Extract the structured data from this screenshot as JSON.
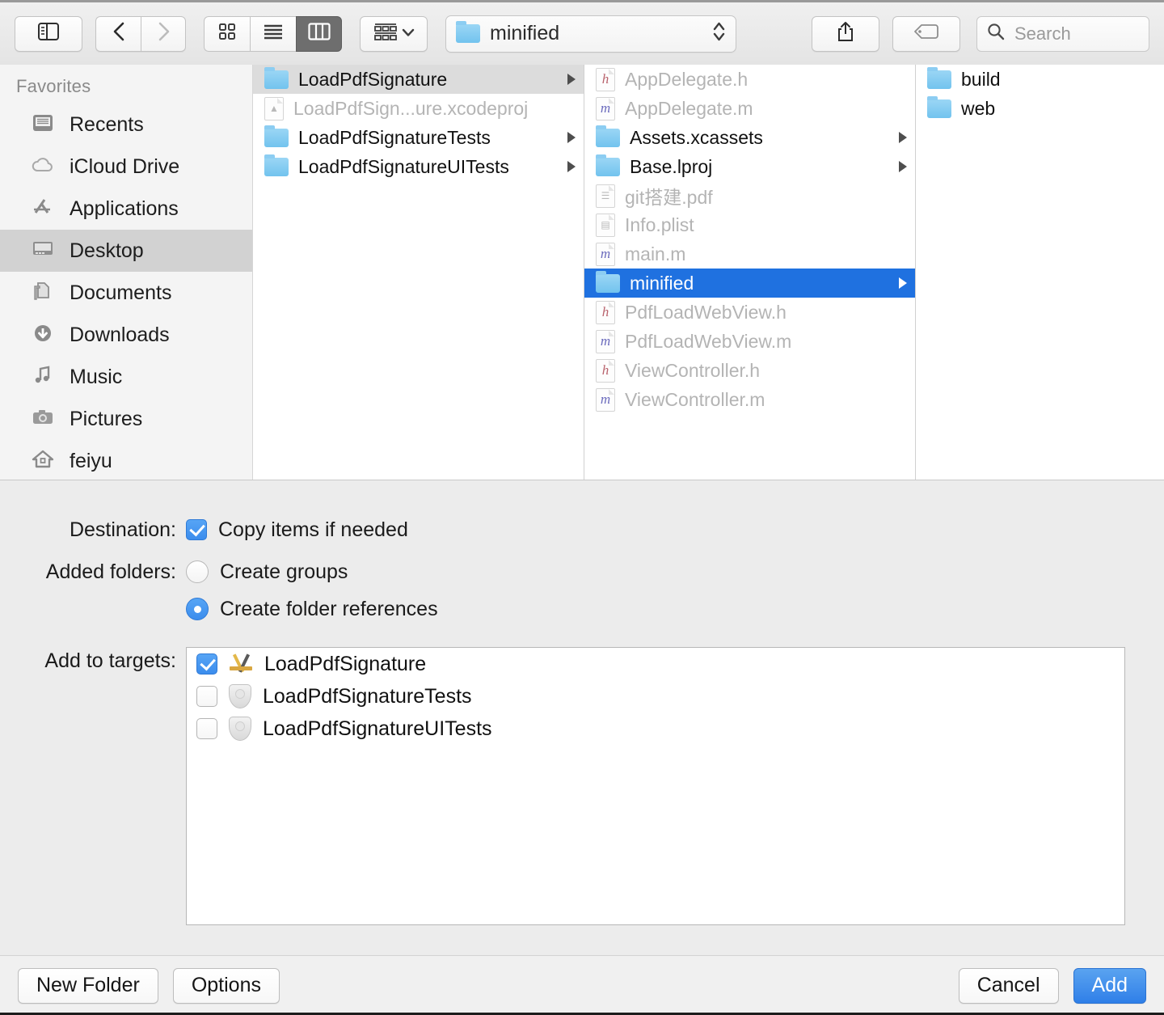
{
  "toolbar": {
    "sidebar_toggle": "sidebar-toggle",
    "back": "back",
    "forward": "forward",
    "view_icon": "icon-view",
    "view_list": "list-view",
    "view_column": "column-view",
    "arrange": "arrange",
    "path_label": "minified",
    "share": "share",
    "tag": "tag",
    "search_placeholder": "Search"
  },
  "sidebar": {
    "header": "Favorites",
    "items": [
      {
        "label": "Recents",
        "icon": "recents-icon",
        "selected": false
      },
      {
        "label": "iCloud Drive",
        "icon": "icloud-icon",
        "selected": false
      },
      {
        "label": "Applications",
        "icon": "applications-icon",
        "selected": false
      },
      {
        "label": "Desktop",
        "icon": "desktop-icon",
        "selected": true
      },
      {
        "label": "Documents",
        "icon": "documents-icon",
        "selected": false
      },
      {
        "label": "Downloads",
        "icon": "downloads-icon",
        "selected": false
      },
      {
        "label": "Music",
        "icon": "music-icon",
        "selected": false
      },
      {
        "label": "Pictures",
        "icon": "pictures-icon",
        "selected": false
      },
      {
        "label": "feiyu",
        "icon": "home-icon",
        "selected": false
      }
    ]
  },
  "columns": [
    {
      "name": "column-1",
      "rows": [
        {
          "label": "LoadPdfSignature",
          "icon": "folder-icon",
          "state": "highlighted",
          "arrow": true,
          "dimmed": false
        },
        {
          "label": "LoadPdfSign...ure.xcodeproj",
          "icon": "xcodeproj-icon",
          "state": "normal",
          "arrow": false,
          "dimmed": true
        },
        {
          "label": "LoadPdfSignatureTests",
          "icon": "folder-icon",
          "state": "normal",
          "arrow": true,
          "dimmed": false
        },
        {
          "label": "LoadPdfSignatureUITests",
          "icon": "folder-icon",
          "state": "normal",
          "arrow": true,
          "dimmed": false
        }
      ]
    },
    {
      "name": "column-2",
      "rows": [
        {
          "label": "AppDelegate.h",
          "icon": "h-file-icon",
          "state": "normal",
          "arrow": false,
          "dimmed": true
        },
        {
          "label": "AppDelegate.m",
          "icon": "m-file-icon",
          "state": "normal",
          "arrow": false,
          "dimmed": true
        },
        {
          "label": "Assets.xcassets",
          "icon": "folder-icon",
          "state": "normal",
          "arrow": true,
          "dimmed": false
        },
        {
          "label": "Base.lproj",
          "icon": "folder-icon",
          "state": "normal",
          "arrow": true,
          "dimmed": false
        },
        {
          "label": "git搭建.pdf",
          "icon": "pdf-file-icon",
          "state": "normal",
          "arrow": false,
          "dimmed": true
        },
        {
          "label": "Info.plist",
          "icon": "plist-file-icon",
          "state": "normal",
          "arrow": false,
          "dimmed": true
        },
        {
          "label": "main.m",
          "icon": "m-file-icon",
          "state": "normal",
          "arrow": false,
          "dimmed": true
        },
        {
          "label": "minified",
          "icon": "folder-icon",
          "state": "selected",
          "arrow": true,
          "dimmed": false
        },
        {
          "label": "PdfLoadWebView.h",
          "icon": "h-file-icon",
          "state": "normal",
          "arrow": false,
          "dimmed": true
        },
        {
          "label": "PdfLoadWebView.m",
          "icon": "m-file-icon",
          "state": "normal",
          "arrow": false,
          "dimmed": true
        },
        {
          "label": "ViewController.h",
          "icon": "h-file-icon",
          "state": "normal",
          "arrow": false,
          "dimmed": true
        },
        {
          "label": "ViewController.m",
          "icon": "m-file-icon",
          "state": "normal",
          "arrow": false,
          "dimmed": true
        }
      ]
    },
    {
      "name": "column-3",
      "rows": [
        {
          "label": "build",
          "icon": "folder-icon",
          "state": "normal",
          "arrow": false,
          "dimmed": false
        },
        {
          "label": "web",
          "icon": "folder-icon",
          "state": "normal",
          "arrow": false,
          "dimmed": false
        }
      ]
    }
  ],
  "options": {
    "destination": {
      "label": "Destination:",
      "checkbox_label": "Copy items if needed",
      "checked": true
    },
    "added_folders": {
      "label": "Added folders:",
      "choices": [
        {
          "label": "Create groups",
          "selected": false
        },
        {
          "label": "Create folder references",
          "selected": true
        }
      ]
    },
    "add_to_targets": {
      "label": "Add to targets:",
      "targets": [
        {
          "label": "LoadPdfSignature",
          "icon": "xcode-app-icon",
          "checked": true
        },
        {
          "label": "LoadPdfSignatureTests",
          "icon": "test-shield-icon",
          "checked": false
        },
        {
          "label": "LoadPdfSignatureUITests",
          "icon": "test-shield-icon",
          "checked": false
        }
      ]
    }
  },
  "bottom_bar": {
    "new_folder": "New Folder",
    "options": "Options",
    "cancel": "Cancel",
    "add": "Add"
  },
  "colors": {
    "selection_blue": "#1f71e0",
    "control_blue": "#3b8ded",
    "primary_button": "#2f7fe8",
    "folder_blue": "#72c3ee",
    "sidebar_bg": "#f4f4f4",
    "panel_bg": "#ececec"
  }
}
